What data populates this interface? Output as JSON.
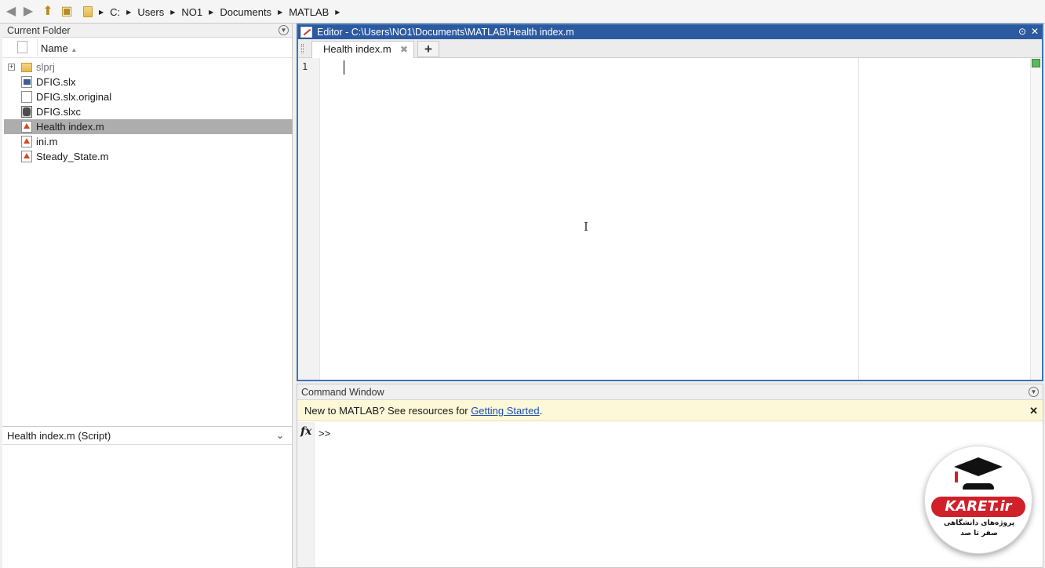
{
  "address_bar": {
    "path": [
      "C:",
      "Users",
      "NO1",
      "Documents",
      "MATLAB"
    ]
  },
  "current_folder": {
    "title": "Current Folder",
    "column_name": "Name",
    "items": [
      {
        "name": "slprj",
        "icon": "folder-icon"
      },
      {
        "name": "DFIG.slx",
        "icon": "simulink-model-icon"
      },
      {
        "name": "DFIG.slx.original",
        "icon": "document-icon"
      },
      {
        "name": "DFIG.slxc",
        "icon": "simulink-cache-icon"
      },
      {
        "name": "Health index.m",
        "icon": "m-file-icon"
      },
      {
        "name": "ini.m",
        "icon": "m-file-icon"
      },
      {
        "name": "Steady_State.m",
        "icon": "m-file-icon"
      }
    ],
    "selected": "Health index.m"
  },
  "details": {
    "header": "Health index.m  (Script)"
  },
  "editor": {
    "title": "Editor - C:\\Users\\NO1\\Documents\\MATLAB\\Health index.m",
    "tab_label": "Health index.m",
    "new_tab": "+",
    "line_number": "1"
  },
  "command_window": {
    "title": "Command Window",
    "banner_text": "New to MATLAB? See resources for ",
    "banner_link": "Getting Started",
    "banner_suffix": ".",
    "fx": "fx",
    "prompt": ">>"
  },
  "watermark": {
    "brand": "KARET.ir",
    "line1": "پروژه‌های دانشگاهی",
    "line2": "صفر تا صد"
  },
  "colors": {
    "editor_titlebar": "#2c5aa0",
    "selection": "#adadad",
    "banner_bg": "#fdf8d8",
    "link": "#1a4fb8",
    "brand_red": "#d0202a"
  }
}
